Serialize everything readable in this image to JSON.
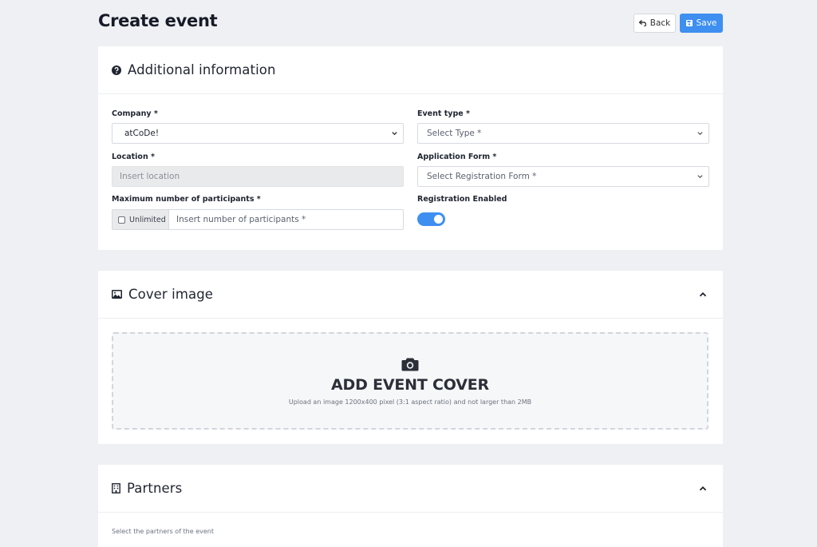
{
  "header": {
    "title": "Create event",
    "back_label": "Back",
    "save_label": "Save"
  },
  "additional_info": {
    "title": "Additional information",
    "company": {
      "label": "Company *",
      "value": "atCoDe!"
    },
    "event_type": {
      "label": "Event type *",
      "placeholder": "Select Type *"
    },
    "location": {
      "label": "Location *",
      "placeholder": "Insert location"
    },
    "application_form": {
      "label": "Application Form *",
      "placeholder": "Select Registration Form *"
    },
    "max_participants": {
      "label": "Maximum number of participants *",
      "unlimited_label": "Unlimited",
      "unlimited_checked": false,
      "placeholder": "Insert number of participants *"
    },
    "registration": {
      "label": "Registration Enabled",
      "enabled": true
    }
  },
  "cover_image": {
    "title": "Cover image",
    "cta": "ADD EVENT COVER",
    "hint": "Upload an image 1200x400 pixel (3:1 aspect ratio) and not larger than 2MB"
  },
  "partners": {
    "title": "Partners",
    "hint": "Select the partners of the event"
  },
  "colors": {
    "accent": "#3e8ff0",
    "background": "#eef0f3"
  }
}
